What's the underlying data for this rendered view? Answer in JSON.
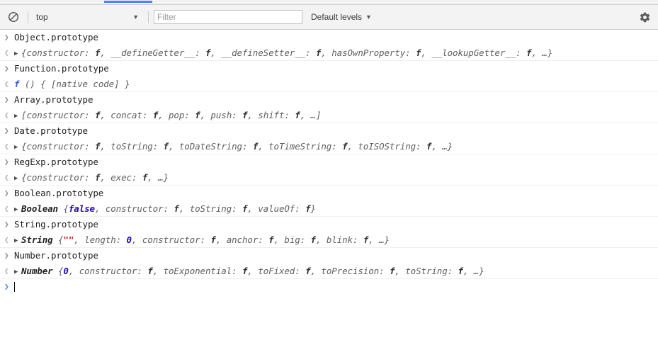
{
  "window": {
    "title": "DevTools Console"
  },
  "tabstrip": {
    "active_tab_accent": "#4285f4"
  },
  "toolbar": {
    "clear_console_icon": "no-entry-icon",
    "context_selector": {
      "value": "top",
      "caret": "▼"
    },
    "filter": {
      "value": "",
      "placeholder": "Filter"
    },
    "log_levels": {
      "label": "Default levels",
      "caret": "▼"
    },
    "settings_icon": "gear-icon"
  },
  "console": {
    "input_marker": "❯",
    "output_marker": "❮",
    "disclosure_marker": "▶",
    "entries": [
      {
        "command": "Object.prototype",
        "result_prefix": "",
        "result_open": "{",
        "result_parts": [
          {
            "text": "constructor: ",
            "kind": "key"
          },
          {
            "text": "f",
            "kind": "fn"
          },
          {
            "text": ", ",
            "kind": "punc"
          },
          {
            "text": "__defineGetter__: ",
            "kind": "key"
          },
          {
            "text": "f",
            "kind": "fn"
          },
          {
            "text": ", ",
            "kind": "punc"
          },
          {
            "text": "__defineSetter__: ",
            "kind": "key"
          },
          {
            "text": "f",
            "kind": "fn"
          },
          {
            "text": ", ",
            "kind": "punc"
          },
          {
            "text": "hasOwnProperty: ",
            "kind": "key"
          },
          {
            "text": "f",
            "kind": "fn"
          },
          {
            "text": ", ",
            "kind": "punc"
          },
          {
            "text": "__lookupGetter__: ",
            "kind": "key"
          },
          {
            "text": "f",
            "kind": "fn"
          },
          {
            "text": ", …",
            "kind": "punc"
          }
        ],
        "result_close": "}",
        "expandable": true
      },
      {
        "command": "Function.prototype",
        "result_prefix": "",
        "result_open": "",
        "result_parts": [
          {
            "text": "f",
            "kind": "fn-blue"
          },
          {
            "text": " () { [native code] }",
            "kind": "punc"
          }
        ],
        "result_close": "",
        "expandable": false
      },
      {
        "command": "Array.prototype",
        "result_prefix": "",
        "result_open": "[",
        "result_parts": [
          {
            "text": "constructor: ",
            "kind": "key"
          },
          {
            "text": "f",
            "kind": "fn"
          },
          {
            "text": ", ",
            "kind": "punc"
          },
          {
            "text": "concat: ",
            "kind": "key"
          },
          {
            "text": "f",
            "kind": "fn"
          },
          {
            "text": ", ",
            "kind": "punc"
          },
          {
            "text": "pop: ",
            "kind": "key"
          },
          {
            "text": "f",
            "kind": "fn"
          },
          {
            "text": ", ",
            "kind": "punc"
          },
          {
            "text": "push: ",
            "kind": "key"
          },
          {
            "text": "f",
            "kind": "fn"
          },
          {
            "text": ", ",
            "kind": "punc"
          },
          {
            "text": "shift: ",
            "kind": "key"
          },
          {
            "text": "f",
            "kind": "fn"
          },
          {
            "text": ", …",
            "kind": "punc"
          }
        ],
        "result_close": "]",
        "expandable": true
      },
      {
        "command": "Date.prototype",
        "result_prefix": "",
        "result_open": "{",
        "result_parts": [
          {
            "text": "constructor: ",
            "kind": "key"
          },
          {
            "text": "f",
            "kind": "fn"
          },
          {
            "text": ", ",
            "kind": "punc"
          },
          {
            "text": "toString: ",
            "kind": "key"
          },
          {
            "text": "f",
            "kind": "fn"
          },
          {
            "text": ", ",
            "kind": "punc"
          },
          {
            "text": "toDateString: ",
            "kind": "key"
          },
          {
            "text": "f",
            "kind": "fn"
          },
          {
            "text": ", ",
            "kind": "punc"
          },
          {
            "text": "toTimeString: ",
            "kind": "key"
          },
          {
            "text": "f",
            "kind": "fn"
          },
          {
            "text": ", ",
            "kind": "punc"
          },
          {
            "text": "toISOString: ",
            "kind": "key"
          },
          {
            "text": "f",
            "kind": "fn"
          },
          {
            "text": ", …",
            "kind": "punc"
          }
        ],
        "result_close": "}",
        "expandable": true
      },
      {
        "command": "RegExp.prototype",
        "result_prefix": "",
        "result_open": "{",
        "result_parts": [
          {
            "text": "constructor: ",
            "kind": "key"
          },
          {
            "text": "f",
            "kind": "fn"
          },
          {
            "text": ", ",
            "kind": "punc"
          },
          {
            "text": "exec: ",
            "kind": "key"
          },
          {
            "text": "f",
            "kind": "fn"
          },
          {
            "text": ", …",
            "kind": "punc"
          }
        ],
        "result_close": "}",
        "expandable": true
      },
      {
        "command": "Boolean.prototype",
        "result_prefix": "Boolean ",
        "result_open": "{",
        "result_parts": [
          {
            "text": "false",
            "kind": "bool"
          },
          {
            "text": ", ",
            "kind": "punc"
          },
          {
            "text": "constructor: ",
            "kind": "key"
          },
          {
            "text": "f",
            "kind": "fn"
          },
          {
            "text": ", ",
            "kind": "punc"
          },
          {
            "text": "toString: ",
            "kind": "key"
          },
          {
            "text": "f",
            "kind": "fn"
          },
          {
            "text": ", ",
            "kind": "punc"
          },
          {
            "text": "valueOf: ",
            "kind": "key"
          },
          {
            "text": "f",
            "kind": "fn"
          }
        ],
        "result_close": "}",
        "expandable": true
      },
      {
        "command": "String.prototype",
        "result_prefix": "String ",
        "result_open": "{",
        "result_parts": [
          {
            "text": "\"\"",
            "kind": "str"
          },
          {
            "text": ", ",
            "kind": "punc"
          },
          {
            "text": "length: ",
            "kind": "key"
          },
          {
            "text": "0",
            "kind": "num"
          },
          {
            "text": ", ",
            "kind": "punc"
          },
          {
            "text": "constructor: ",
            "kind": "key"
          },
          {
            "text": "f",
            "kind": "fn"
          },
          {
            "text": ", ",
            "kind": "punc"
          },
          {
            "text": "anchor: ",
            "kind": "key"
          },
          {
            "text": "f",
            "kind": "fn"
          },
          {
            "text": ", ",
            "kind": "punc"
          },
          {
            "text": "big: ",
            "kind": "key"
          },
          {
            "text": "f",
            "kind": "fn"
          },
          {
            "text": ", ",
            "kind": "punc"
          },
          {
            "text": "blink: ",
            "kind": "key"
          },
          {
            "text": "f",
            "kind": "fn"
          },
          {
            "text": ", …",
            "kind": "punc"
          }
        ],
        "result_close": "}",
        "expandable": true
      },
      {
        "command": "Number.prototype",
        "result_prefix": "Number ",
        "result_open": "{",
        "result_parts": [
          {
            "text": "0",
            "kind": "num"
          },
          {
            "text": ", ",
            "kind": "punc"
          },
          {
            "text": "constructor: ",
            "kind": "key"
          },
          {
            "text": "f",
            "kind": "fn"
          },
          {
            "text": ", ",
            "kind": "punc"
          },
          {
            "text": "toExponential: ",
            "kind": "key"
          },
          {
            "text": "f",
            "kind": "fn"
          },
          {
            "text": ", ",
            "kind": "punc"
          },
          {
            "text": "toFixed: ",
            "kind": "key"
          },
          {
            "text": "f",
            "kind": "fn"
          },
          {
            "text": ", ",
            "kind": "punc"
          },
          {
            "text": "toPrecision: ",
            "kind": "key"
          },
          {
            "text": "f",
            "kind": "fn"
          },
          {
            "text": ", ",
            "kind": "punc"
          },
          {
            "text": "toString: ",
            "kind": "key"
          },
          {
            "text": "f",
            "kind": "fn"
          },
          {
            "text": ", …",
            "kind": "punc"
          }
        ],
        "result_close": "}",
        "expandable": true
      }
    ],
    "prompt": {
      "marker": "❯",
      "value": ""
    }
  },
  "colors": {
    "accent": "#4285f4",
    "toolbar_bg": "#f3f3f3",
    "console_bg": "#ffffff",
    "string": "#c41a16",
    "number": "#1c00cf",
    "boolean": "#1c00cf",
    "separator": "#f0f0f0"
  }
}
